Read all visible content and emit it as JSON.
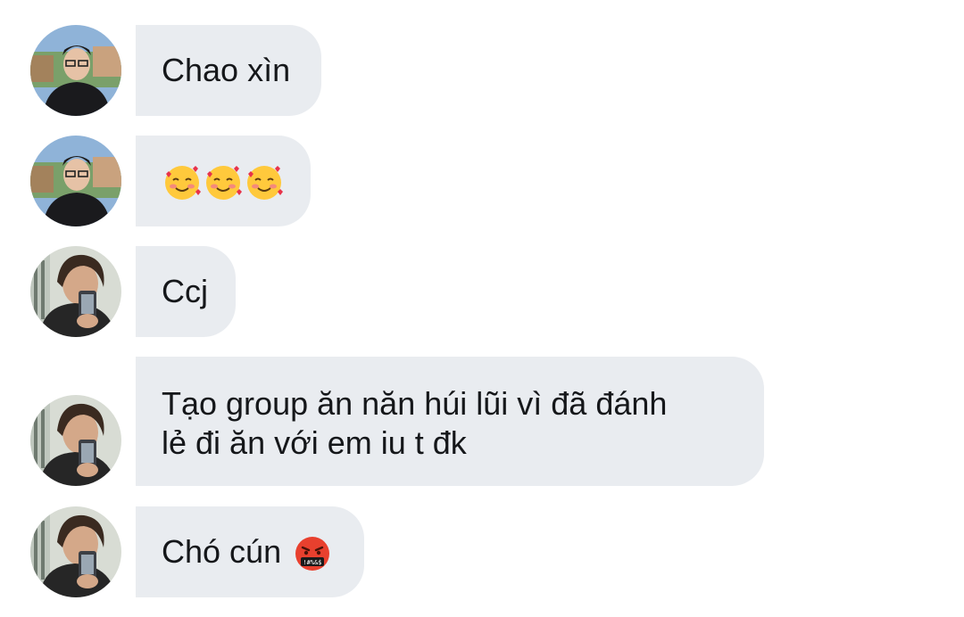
{
  "conversation": {
    "messages": [
      {
        "sender": "user-a",
        "text": "Chao xìn",
        "emojis": []
      },
      {
        "sender": "user-a",
        "text": "",
        "emojis": [
          "smiling-face-with-hearts",
          "smiling-face-with-hearts",
          "smiling-face-with-hearts"
        ]
      },
      {
        "sender": "user-b",
        "text": "Ccj",
        "emojis": []
      },
      {
        "sender": "user-b",
        "text": "Tạo group ăn năn húi lũi vì đã đánh\nlẻ đi ăn với em iu t đk",
        "emojis": []
      },
      {
        "sender": "user-b",
        "text": "Chó cún",
        "emojis": [
          "face-with-symbols-on-mouth"
        ]
      }
    ]
  },
  "colors": {
    "bubble_background": "#e9ecf0",
    "text": "#15171a",
    "page_background": "#ffffff"
  }
}
